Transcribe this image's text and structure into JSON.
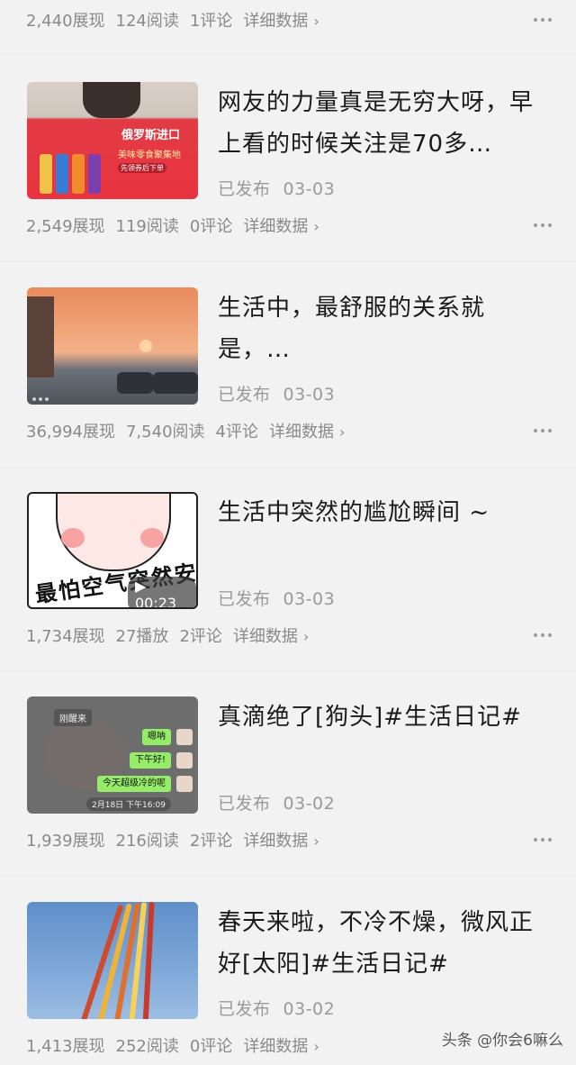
{
  "top_stats": {
    "impressions": "2,440展现",
    "reads": "124阅读",
    "comments": "1评论",
    "detail": "详细数据"
  },
  "articles": [
    {
      "title": "网友的力量真是无穷大呀，早上看的时候关注是70多…",
      "status": "已发布",
      "date": "03-03",
      "thumb_text": {
        "brand": "俄罗斯进口",
        "sub": "美味零食聚集地",
        "tag": "先领券后下单"
      },
      "stats": {
        "impressions": "2,549展现",
        "reads": "119阅读",
        "comments": "0评论",
        "detail": "详细数据"
      }
    },
    {
      "title": "生活中，最舒服的关系就是，…",
      "status": "已发布",
      "date": "03-03",
      "stats": {
        "impressions": "36,994展现",
        "reads": "7,540阅读",
        "comments": "4评论",
        "detail": "详细数据"
      }
    },
    {
      "title": "生活中突然的尴尬瞬间 ~",
      "status": "已发布",
      "date": "03-03",
      "thumb_text": {
        "caption": "最怕空气突然安静",
        "duration": "00:23"
      },
      "stats": {
        "impressions": "1,734展现",
        "reads": "27播放",
        "comments": "2评论",
        "detail": "详细数据"
      }
    },
    {
      "title": "真滴绝了[狗头]#生活日记#",
      "status": "已发布",
      "date": "03-02",
      "thumb_text": {
        "name": "刚醒来",
        "bubble1": "嗯呐",
        "bubble2": "下午好!",
        "bubble3": "今天超级冷的呢",
        "time": "2月18日 下午16:09"
      },
      "stats": {
        "impressions": "1,939展现",
        "reads": "216阅读",
        "comments": "2评论",
        "detail": "详细数据"
      }
    },
    {
      "title": "春天来啦，不冷不燥，微风正好[太阳]#生活日记#",
      "status": "已发布",
      "date": "03-02",
      "stats": {
        "impressions": "1,413展现",
        "reads": "252阅读",
        "comments": "0评论",
        "detail": "详细数据"
      }
    }
  ],
  "watermark": "头条 @你会6嘛么",
  "colors": {
    "background": "#f2f2f2",
    "title": "#1a1a1a",
    "meta": "#9a9a9a",
    "stats": "#8a8a8a"
  }
}
